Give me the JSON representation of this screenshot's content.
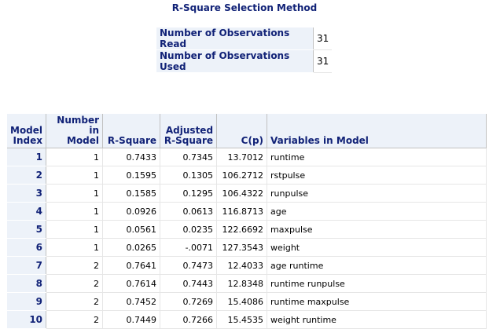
{
  "title": "R-Square Selection Method",
  "observations": [
    {
      "label": "Number of Observations Read",
      "value": "31"
    },
    {
      "label": "Number of Observations Used",
      "value": "31"
    }
  ],
  "model_table": {
    "headers": {
      "index_line1": "Model",
      "index_line2": "Index",
      "number_line1": "Number in",
      "number_line2": "Model",
      "rsquare": "R-Square",
      "adj_line1": "Adjusted",
      "adj_line2": "R-Square",
      "cp": "C(p)",
      "vars": "Variables in Model"
    },
    "rows": [
      {
        "index": "1",
        "number": "1",
        "rsq": "0.7433",
        "adj": "0.7345",
        "cp": "13.7012",
        "vars": "runtime"
      },
      {
        "index": "2",
        "number": "1",
        "rsq": "0.1595",
        "adj": "0.1305",
        "cp": "106.2712",
        "vars": "rstpulse"
      },
      {
        "index": "3",
        "number": "1",
        "rsq": "0.1585",
        "adj": "0.1295",
        "cp": "106.4322",
        "vars": "runpulse"
      },
      {
        "index": "4",
        "number": "1",
        "rsq": "0.0926",
        "adj": "0.0613",
        "cp": "116.8713",
        "vars": "age"
      },
      {
        "index": "5",
        "number": "1",
        "rsq": "0.0561",
        "adj": "0.0235",
        "cp": "122.6692",
        "vars": "maxpulse"
      },
      {
        "index": "6",
        "number": "1",
        "rsq": "0.0265",
        "adj": "-.0071",
        "cp": "127.3543",
        "vars": "weight"
      },
      {
        "index": "7",
        "number": "2",
        "rsq": "0.7641",
        "adj": "0.7473",
        "cp": "12.4033",
        "vars": "age runtime"
      },
      {
        "index": "8",
        "number": "2",
        "rsq": "0.7614",
        "adj": "0.7443",
        "cp": "12.8348",
        "vars": "runtime runpulse"
      },
      {
        "index": "9",
        "number": "2",
        "rsq": "0.7452",
        "adj": "0.7269",
        "cp": "15.4086",
        "vars": "runtime maxpulse"
      },
      {
        "index": "10",
        "number": "2",
        "rsq": "0.7449",
        "adj": "0.7266",
        "cp": "15.4535",
        "vars": "weight runtime"
      }
    ]
  },
  "colors": {
    "header_bg": "#edf2f9",
    "header_text": "#112277",
    "grid": "#c1c1c1"
  }
}
